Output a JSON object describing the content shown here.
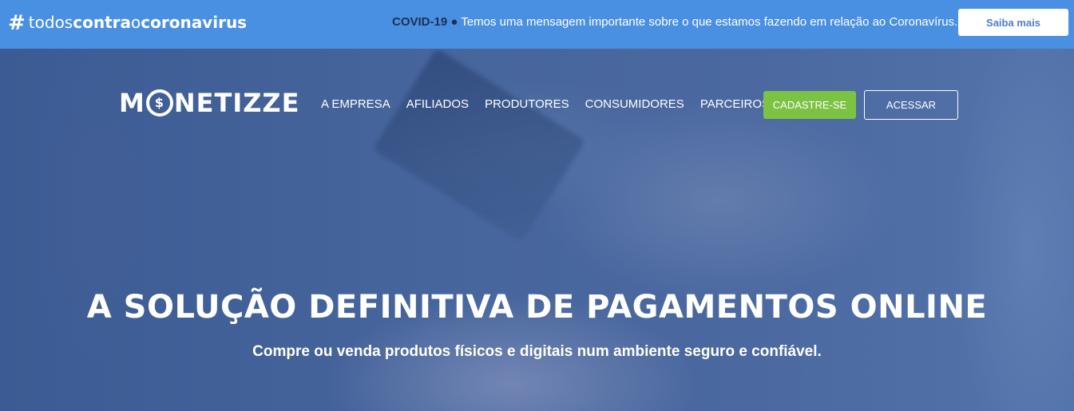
{
  "banner": {
    "hashtag_symbol": "#",
    "hashtag_parts": [
      "todos",
      "contra",
      "o",
      "coronavirus"
    ],
    "notice_label": "COVID-19",
    "notice_dot": "●",
    "notice_text": "Temos uma mensagem importante sobre o que estamos fazendo em relação ao Coronavírus.",
    "cta_label": "Saiba mais"
  },
  "header": {
    "logo_prefix": "M",
    "logo_coin": "$",
    "logo_suffix": "NETIZZE",
    "nav": [
      "A EMPRESA",
      "AFILIADOS",
      "PRODUTORES",
      "CONSUMIDORES",
      "PARCEIROS"
    ],
    "signup_label": "CADASTRE-SE",
    "login_label": "ACESSAR"
  },
  "hero": {
    "headline": "A SOLUÇÃO DEFINITIVA DE PAGAMENTOS ONLINE",
    "subheadline": "Compre ou venda produtos físicos e digitais num ambiente seguro e confiável."
  },
  "colors": {
    "banner_bg": "#4a90e2",
    "signup_bg": "#7cc243",
    "hero_overlay": "#3f5f95"
  }
}
